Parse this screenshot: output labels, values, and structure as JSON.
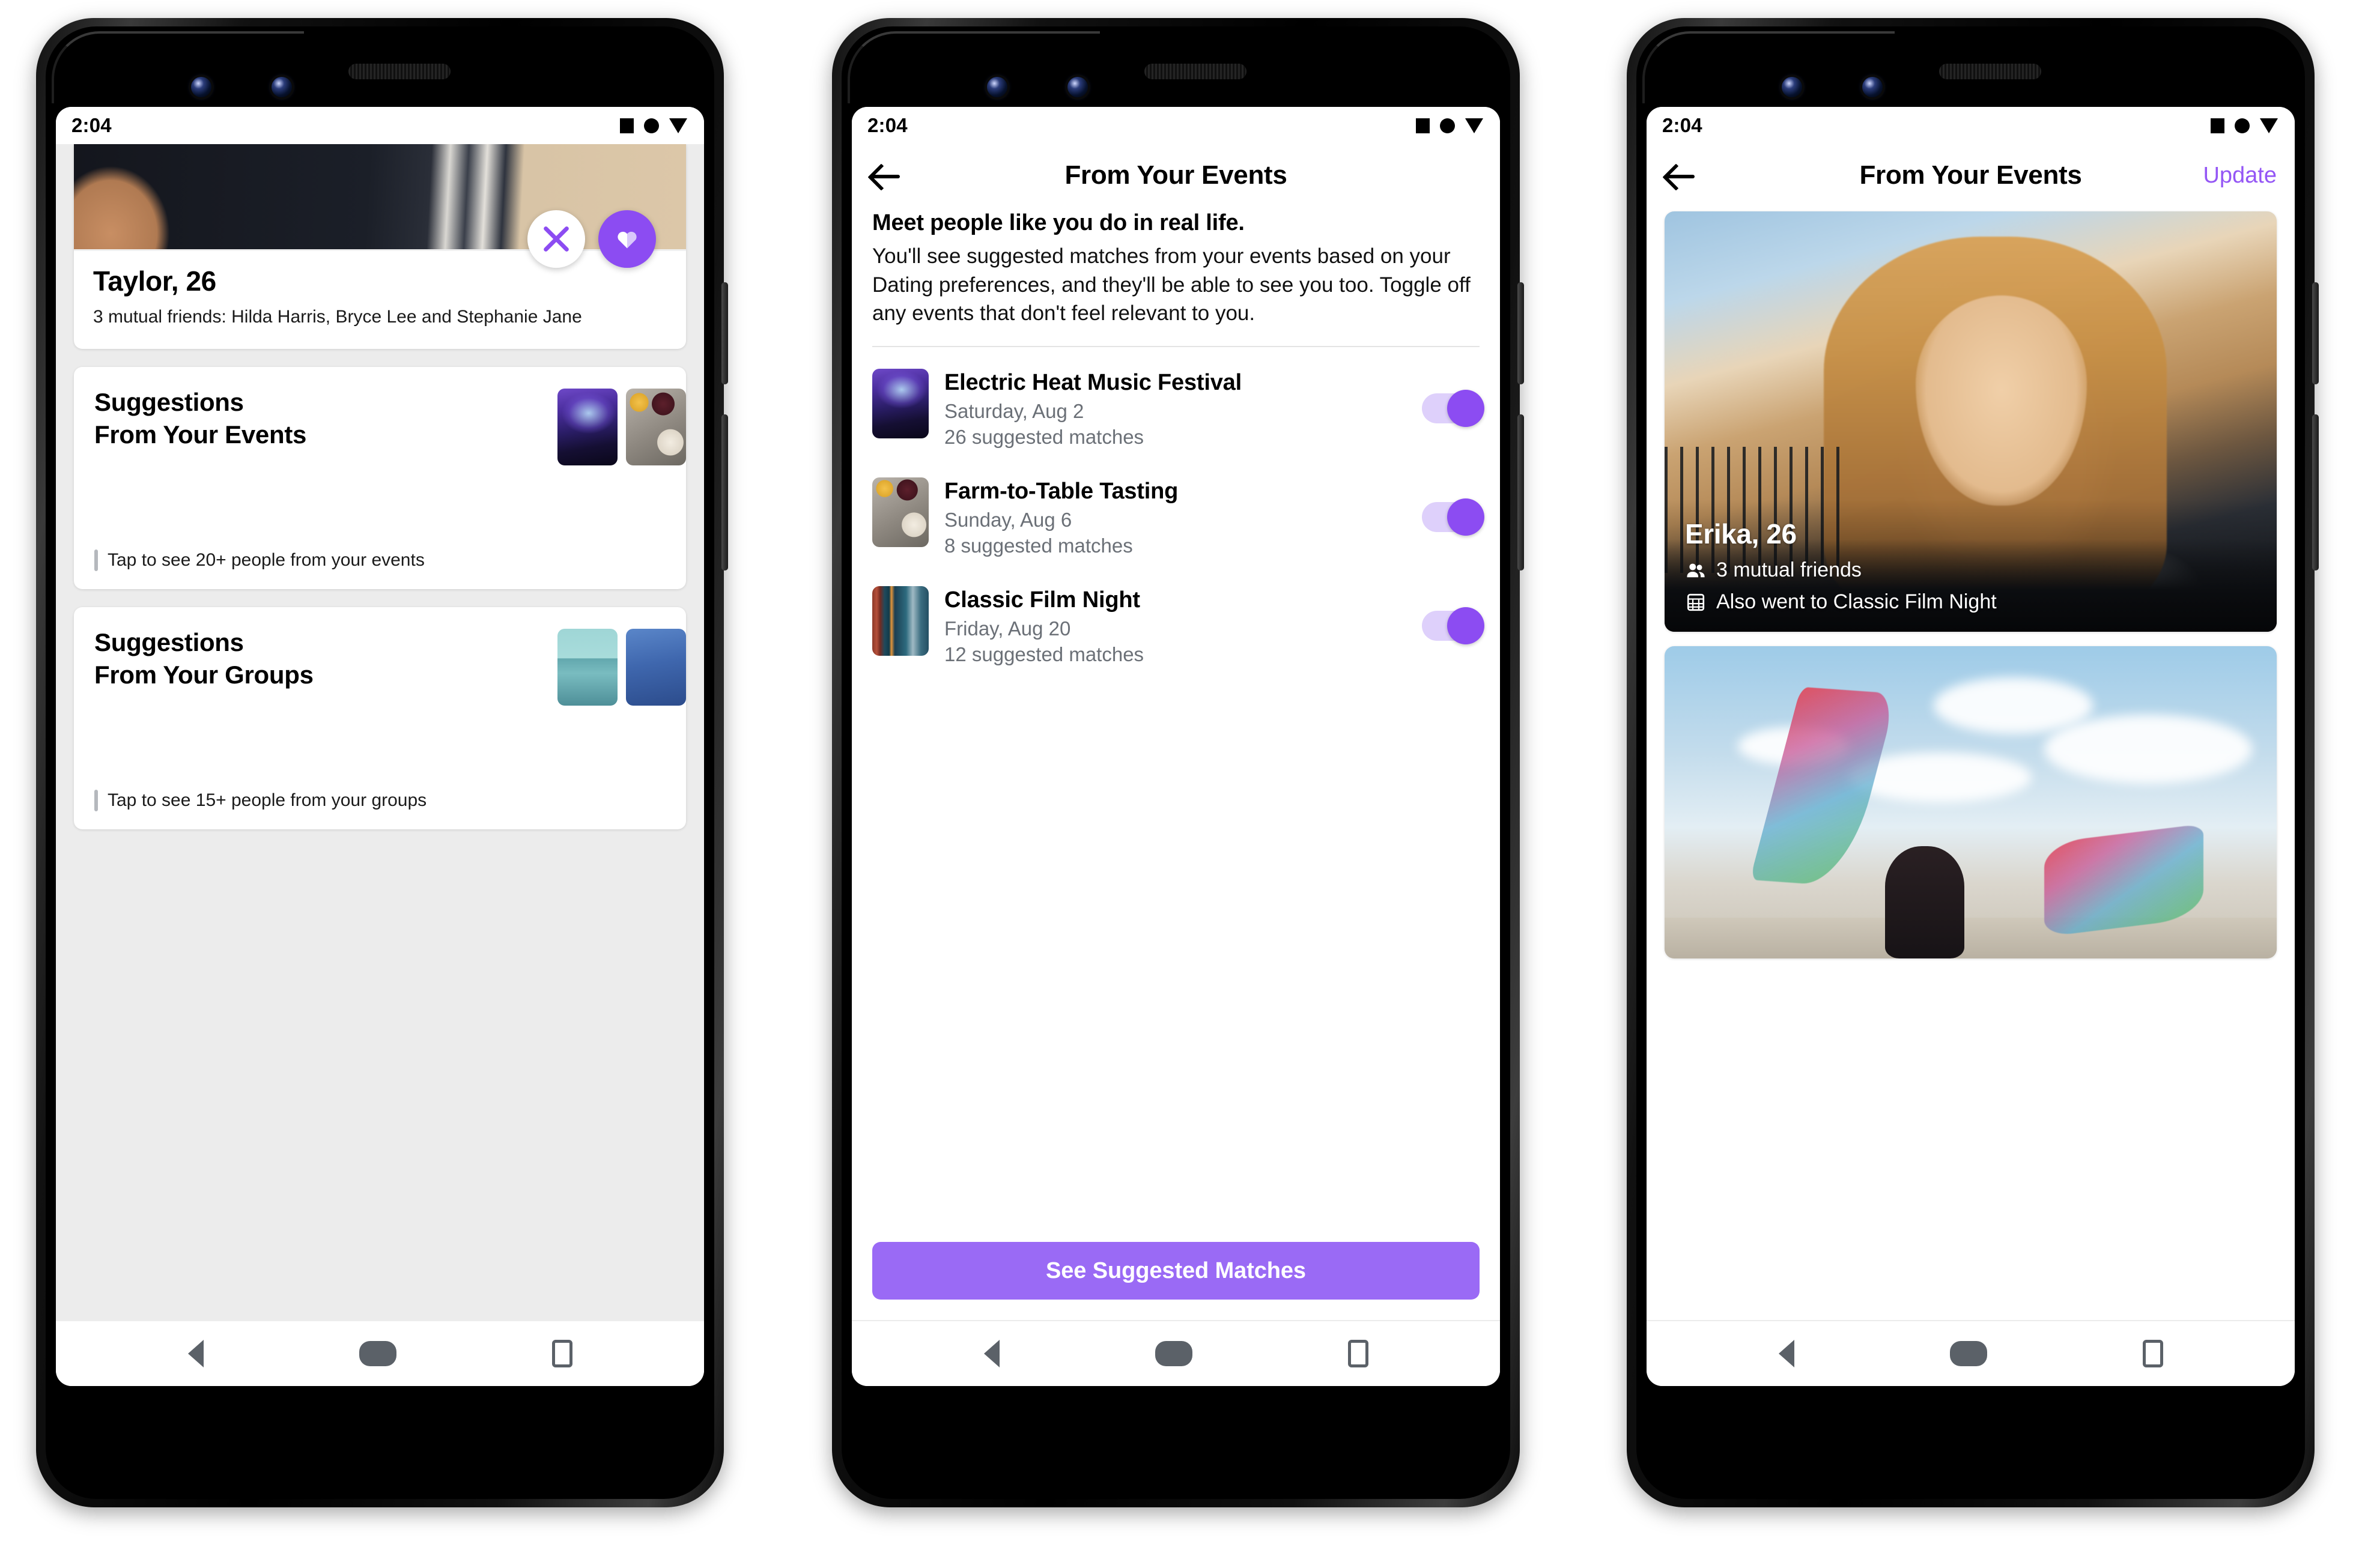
{
  "meta": {
    "app": "Facebook Dating",
    "accent_purple": "#8C4CF2",
    "accent_purple_light": "#9A6AF5",
    "toggle_track": "#DED0FB",
    "screen_bg": "#FFFFFF",
    "feed_bg": "#ECECEC",
    "muted_text": "#6B7077",
    "nav_icon": "#5B6168"
  },
  "status_bar": {
    "time": "2:04",
    "icons": [
      "square-icon",
      "circle-icon",
      "triangle-down-icon"
    ]
  },
  "nav_bar": {
    "back": "back-triangle-icon",
    "home": "home-pill-icon",
    "recents": "recents-square-icon"
  },
  "phone1": {
    "profile_card": {
      "photo": "profile-photo-taylor",
      "name": "Taylor, 26",
      "mutuals": "3 mutual friends: Hilda Harris, Bryce Lee and Stephanie Jane",
      "pass_button": "pass-x-icon",
      "like_button": "like-heart-icon"
    },
    "suggestion_cards": [
      {
        "title": "Suggestions\nFrom Your Events",
        "thumbs": [
          "concert-thumbnail",
          "food-thumbnail"
        ],
        "tap_text": "Tap to see 20+ people from your events"
      },
      {
        "title": "Suggestions\nFrom Your Groups",
        "thumbs": [
          "glass-building-thumbnail",
          "blue-landscape-thumbnail"
        ],
        "tap_text": "Tap to see 15+ people from your groups"
      }
    ]
  },
  "phone2": {
    "topbar": {
      "back": "back-arrow-icon",
      "title": "From Your Events"
    },
    "intro": {
      "heading": "Meet people like you do in real life.",
      "body": "You'll see suggested matches from your events based on your Dating preferences, and they'll be able to see you too. Toggle off any events that don't feel relevant to you."
    },
    "events": [
      {
        "thumb": "concert-thumbnail",
        "title": "Electric Heat Music Festival",
        "date": "Saturday, Aug 2",
        "matches": "26 suggested matches",
        "toggle_on": true
      },
      {
        "thumb": "food-thumbnail",
        "title": "Farm-to-Table Tasting",
        "date": "Sunday, Aug 6",
        "matches": "8 suggested matches",
        "toggle_on": true
      },
      {
        "thumb": "cinema-thumbnail",
        "title": "Classic Film Night",
        "date": "Friday, Aug 20",
        "matches": "12 suggested matches",
        "toggle_on": true
      }
    ],
    "cta_label": "See Suggested Matches"
  },
  "phone3": {
    "topbar": {
      "back": "back-arrow-icon",
      "title": "From Your Events",
      "action": "Update"
    },
    "cards": [
      {
        "photo": "profile-photo-erika",
        "name": "Erika, 26",
        "lines": [
          {
            "icon": "friends-icon",
            "text": "3 mutual friends"
          },
          {
            "icon": "calendar-icon",
            "text": "Also went to Classic Film Night"
          }
        ]
      },
      {
        "photo": "profile-photo-desert-dancer"
      }
    ]
  }
}
